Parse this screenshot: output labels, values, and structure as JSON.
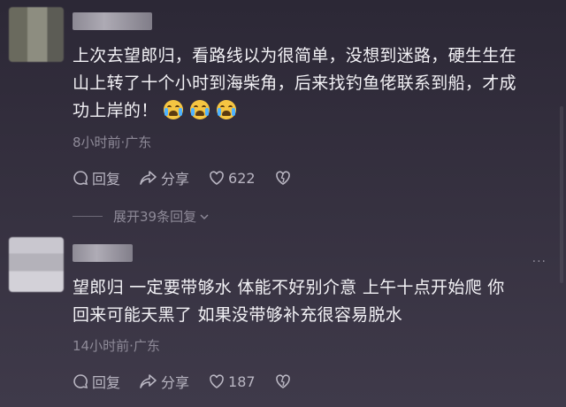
{
  "comments": [
    {
      "text_line1": "上次去望郎归，看路线以为很简单，没想到迷路，硬生生在",
      "text_line2": "山上转了十个小时到海柴角，后来找钓鱼佬联系到船，才成",
      "text_line3": "功上岸的！",
      "emojis": [
        "crying-face",
        "crying-face",
        "crying-face"
      ],
      "meta": "8小时前·广东",
      "reply_label": "回复",
      "share_label": "分享",
      "like_count": "622",
      "expand_label": "展开39条回复"
    },
    {
      "text_line1": "望郎归 一定要带够水  体能不好别介意  上午十点开始爬 你",
      "text_line2": "回来可能天黑了  如果没带够补充很容易脱水",
      "meta": "14小时前·广东",
      "reply_label": "回复",
      "share_label": "分享",
      "like_count": "187"
    }
  ],
  "more_menu_glyph": "···",
  "colors": {
    "emoji": "#f5c542",
    "meta": "#8e8a98",
    "text": "#f3f2f6"
  }
}
